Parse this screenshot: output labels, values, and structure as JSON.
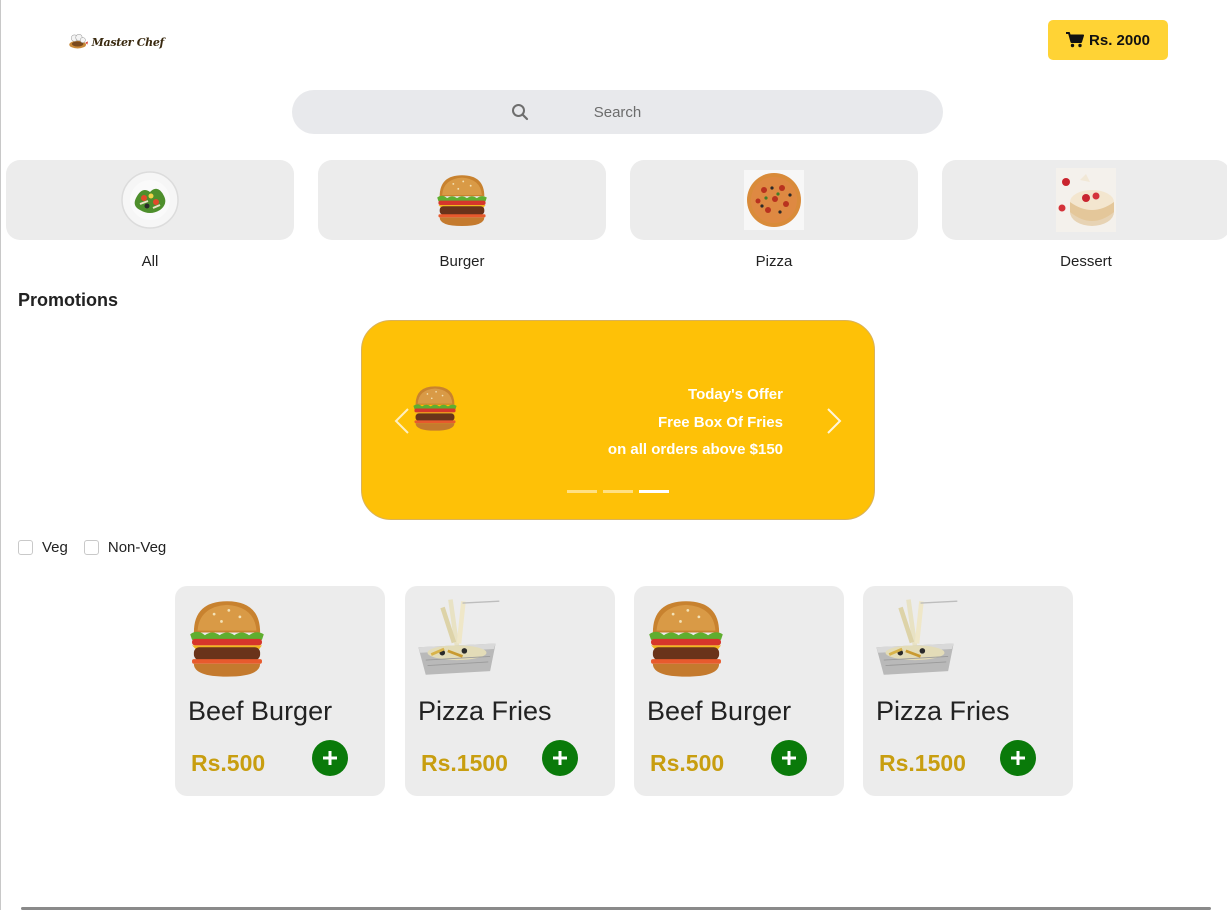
{
  "header": {
    "logo_text": "Master Chef",
    "cart_label": "Rs. 2000",
    "accent_color": "#ffd335"
  },
  "search": {
    "placeholder": "Search"
  },
  "categories": [
    {
      "label": "All",
      "icon": "salad-icon"
    },
    {
      "label": "Burger",
      "icon": "burger-icon"
    },
    {
      "label": "Pizza",
      "icon": "pizza-icon"
    },
    {
      "label": "Dessert",
      "icon": "dessert-icon"
    }
  ],
  "promotions": {
    "title": "Promotions",
    "slide": {
      "line1": "Today's Offer",
      "line2": "Free Box Of Fries",
      "line3": "on all orders above $150",
      "image": "burger-icon"
    },
    "slide_count": 3,
    "active_slide": 3,
    "background_color": "#fec107"
  },
  "filters": [
    {
      "label": "Veg",
      "checked": false
    },
    {
      "label": "Non-Veg",
      "checked": false
    }
  ],
  "products": [
    {
      "name": "Beef Burger",
      "price": "Rs.500",
      "image": "burger-icon"
    },
    {
      "name": "Pizza Fries",
      "price": "Rs.1500",
      "image": "fries-tray-icon"
    },
    {
      "name": "Beef Burger",
      "price": "Rs.500",
      "image": "burger-icon"
    },
    {
      "name": "Pizza Fries",
      "price": "Rs.1500",
      "image": "fries-tray-icon"
    }
  ],
  "colors": {
    "price": "#c89e10",
    "add_button": "#0a7a0a",
    "tile_background": "#ececec"
  }
}
